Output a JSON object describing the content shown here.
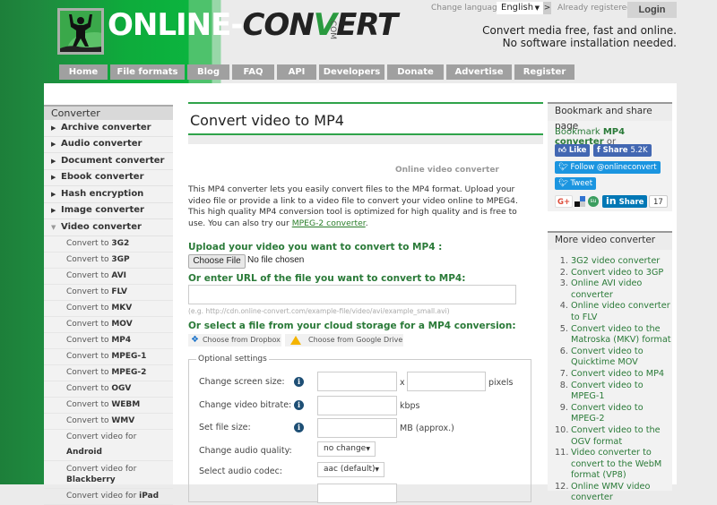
{
  "header": {
    "logo_text_a": "ONLINE-",
    "logo_text_b1": "CON",
    "logo_text_b2": "V",
    "logo_text_b3": "ERT",
    "logo_com": ".COM",
    "language_label": "Change language:",
    "language_value": "English",
    "language_go": ">",
    "registered_label": "Already registered?",
    "login_label": "Login",
    "tagline_1": "Convert media free, fast and online.",
    "tagline_2": "No software installation needed."
  },
  "nav": [
    "Home",
    "File formats",
    "Blog",
    "FAQ",
    "API",
    "Developers",
    "Donate",
    "Advertise",
    "Register"
  ],
  "sidebar": {
    "heading": "Converter",
    "items": [
      "Archive converter",
      "Audio converter",
      "Document converter",
      "Ebook converter",
      "Hash encryption",
      "Image converter",
      "Video converter"
    ],
    "sub_items": [
      {
        "prefix": "Convert to ",
        "bold": "3G2"
      },
      {
        "prefix": "Convert to ",
        "bold": "3GP"
      },
      {
        "prefix": "Convert to ",
        "bold": "AVI"
      },
      {
        "prefix": "Convert to ",
        "bold": "FLV"
      },
      {
        "prefix": "Convert to ",
        "bold": "MKV"
      },
      {
        "prefix": "Convert to ",
        "bold": "MOV"
      },
      {
        "prefix": "Convert to ",
        "bold": "MP4"
      },
      {
        "prefix": "Convert to ",
        "bold": "MPEG-1"
      },
      {
        "prefix": "Convert to ",
        "bold": "MPEG-2"
      },
      {
        "prefix": "Convert to ",
        "bold": "OGV"
      },
      {
        "prefix": "Convert to ",
        "bold": "WEBM"
      },
      {
        "prefix": "Convert to ",
        "bold": "WMV"
      },
      {
        "prefix": "Convert video for ",
        "bold": "Android"
      },
      {
        "prefix": "Convert video for ",
        "bold": "Blackberry"
      },
      {
        "prefix": "Convert video for ",
        "bold": "iPad"
      }
    ]
  },
  "main": {
    "title": "Convert video to MP4",
    "subtitle": "Online video converter",
    "description": "This MP4 converter lets you easily convert files to the MP4 format. Upload your video file or provide a link to a video file to convert your video online to MPEG4. This high quality MP4 conversion tool is optimized for high quality and is free to use. You can also try our ",
    "description_link": "MPEG-2 converter",
    "description_end": ".",
    "upload_label": "Upload your video you want to convert to MP4 :",
    "choose_file": "Choose File",
    "no_file": "No file chosen",
    "url_label": "Or enter URL of the file you want to convert to MP4:",
    "url_value": "",
    "url_example": "(e.g. http://cdn.online-convert.com/example-file/video/avi/example_small.avi)",
    "cloud_label": "Or select a file from your cloud storage for a MP4 conversion:",
    "dropbox_btn": "Choose from Dropbox",
    "gdrive_btn": "Choose from Google Drive",
    "optional_legend": "Optional settings",
    "settings": {
      "screen_size_label": "Change screen size:",
      "screen_size_x": "x",
      "screen_size_unit": "pixels",
      "bitrate_label": "Change video bitrate:",
      "bitrate_unit": "kbps",
      "file_size_label": "Set file size:",
      "file_size_unit": "MB (approx.)",
      "audio_quality_label": "Change audio quality:",
      "audio_quality_value": "no change",
      "audio_codec_label": "Select audio codec:",
      "audio_codec_value": "aac (default)"
    }
  },
  "right": {
    "bookmark_heading": "Bookmark and share page",
    "bookmark_text": "Bookmark ",
    "bookmark_bold": "MP4 converter",
    "bookmark_or": " or",
    "like": "Like",
    "share": "Share",
    "share_count": "5.2K",
    "follow": "Follow @onlineconvert",
    "tweet": "Tweet",
    "gplus": "G+",
    "linkedin_share": "Share",
    "linkedin_count": "17",
    "more_heading": "More video converter",
    "more_items": [
      "3G2 video converter",
      "Convert video to 3GP",
      "Online AVI video converter",
      "Online video converter to FLV",
      "Convert video to the Matroska (MKV) format",
      "Convert video to Quicktime MOV",
      "Convert video to MP4",
      "Convert video to MPEG-1",
      "Convert video to MPEG-2",
      "Convert video to the OGV format",
      "Video converter to convert to the WebM format (VP8)",
      "Online WMV video converter"
    ]
  },
  "colors": {
    "brand_green": "#2fa34a",
    "link_green": "#2a7a38",
    "nav_grey": "#a0a0a0",
    "facebook": "#4267b2",
    "twitter": "#1b95e0",
    "linkedin": "#0077b5"
  }
}
